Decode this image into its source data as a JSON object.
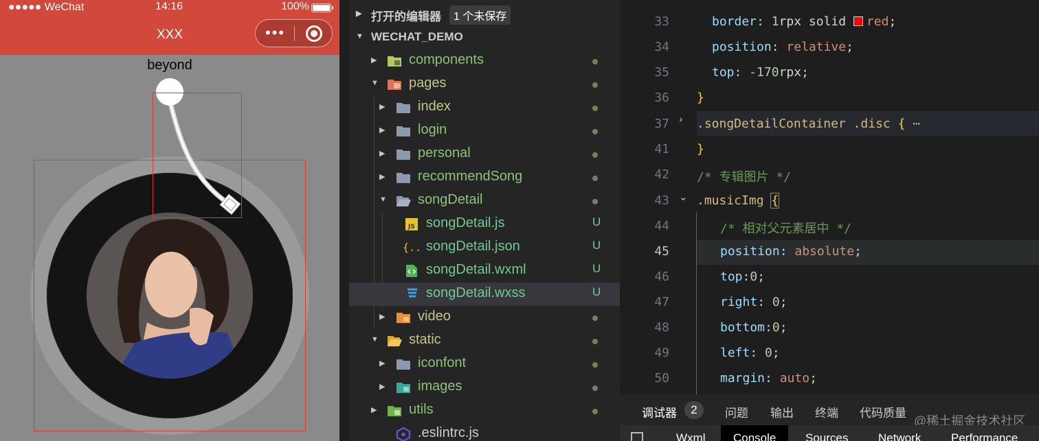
{
  "phone": {
    "status_left": "●●●●● WeChat",
    "status_time": "14:16",
    "status_battery": "100%",
    "nav_title": "XXX",
    "capsule_more": "•••",
    "song_author": "beyond"
  },
  "explorer": {
    "open_editors_label": "打开的编辑器",
    "open_editors_badge": "1 个未保存",
    "project_label": "WECHAT_DEMO",
    "items": [
      {
        "label": "components",
        "status": "dot"
      },
      {
        "label": "pages",
        "status": "dot"
      },
      {
        "label": "index",
        "status": "dot"
      },
      {
        "label": "login",
        "status": "dot"
      },
      {
        "label": "personal",
        "status": "dot"
      },
      {
        "label": "recommendSong",
        "status": "dot"
      },
      {
        "label": "songDetail",
        "status": "dot"
      },
      {
        "label": "songDetail.js",
        "status": "U",
        "icon_text": "JS"
      },
      {
        "label": "songDetail.json",
        "status": "U",
        "icon_text": "{..}"
      },
      {
        "label": "songDetail.wxml",
        "status": "U",
        "icon_text": "<>"
      },
      {
        "label": "songDetail.wxss",
        "status": "U"
      },
      {
        "label": "video",
        "status": "dot"
      },
      {
        "label": "static",
        "status": "dot"
      },
      {
        "label": "iconfont",
        "status": "dot"
      },
      {
        "label": "images",
        "status": "dot"
      },
      {
        "label": "utils",
        "status": "dot"
      },
      {
        "label": ".eslintrc.js",
        "status": ""
      }
    ]
  },
  "editor": {
    "lines": [
      {
        "n": "33",
        "prop": "border",
        "colon": ": ",
        "num": "1",
        "rest": "rpx solid ",
        "val": "red",
        "end": ";"
      },
      {
        "n": "34",
        "prop": "position",
        "colon": ": ",
        "val": "relative",
        "end": ";"
      },
      {
        "n": "35",
        "prop": "top",
        "colon": ": ",
        "num": "-170",
        "rest": "rpx",
        "end": ";"
      },
      {
        "n": "36",
        "text": "}"
      },
      {
        "n": "37",
        "selector": ".songDetailContainer .disc",
        "brace": " {",
        "ellipsis": "⋯"
      },
      {
        "n": "41",
        "text": "}"
      },
      {
        "n": "42",
        "comment": "/* 专辑图片 */"
      },
      {
        "n": "43",
        "selector": ".musicImg",
        "brace": "{"
      },
      {
        "n": "44",
        "comment": "/* 相对父元素居中 */"
      },
      {
        "n": "45",
        "prop": "position",
        "colon": ": ",
        "val": "absolute",
        "end": ";"
      },
      {
        "n": "46",
        "prop": "top",
        "colon": ":",
        "num": "0",
        "end": ";"
      },
      {
        "n": "47",
        "prop": "right",
        "colon": ": ",
        "num": "0",
        "end": ";"
      },
      {
        "n": "48",
        "prop": "bottom",
        "colon": ":",
        "num": "0",
        "end": ";"
      },
      {
        "n": "49",
        "prop": "left",
        "colon": ": ",
        "num": "0",
        "end": ";"
      },
      {
        "n": "50",
        "prop": "margin",
        "colon": ": ",
        "val": "auto",
        "end": ";"
      }
    ],
    "current_line": "45"
  },
  "panel": {
    "tabs": [
      "调试器",
      "问题",
      "输出",
      "终端",
      "代码质量"
    ],
    "debug_badge": "2",
    "watermark": "@稀土掘金技术社区",
    "devtools_tabs": [
      "Wxml",
      "Console",
      "Sources",
      "Network",
      "Performance"
    ],
    "devtools_active": "Console"
  },
  "colors": {
    "phone_header": "#d2493b",
    "phone_background": "#8a8a8a",
    "outline_red": "#e23a2a",
    "explorer_bg": "#252526",
    "editor_bg": "#1e1e1e",
    "untracked_green": "#73c991"
  }
}
